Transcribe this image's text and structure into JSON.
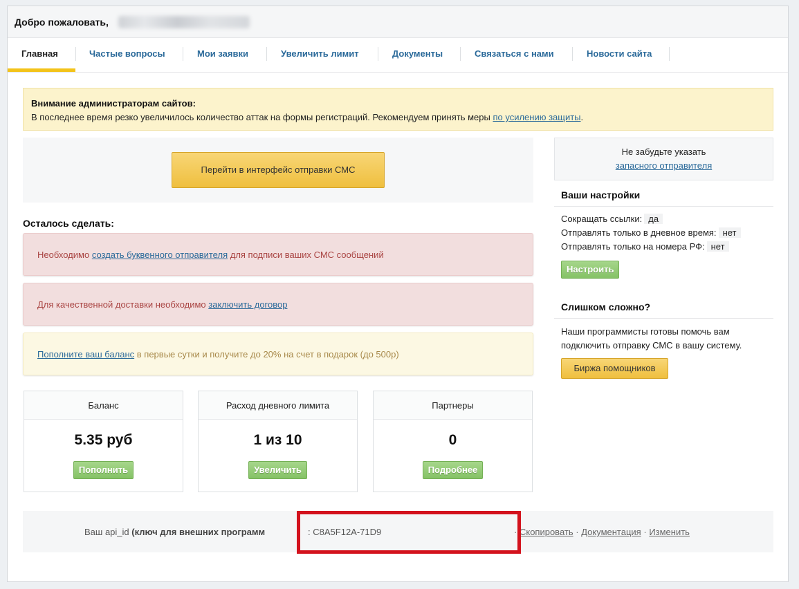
{
  "header": {
    "welcome": "Добро пожаловать,"
  },
  "nav": {
    "tabs": [
      {
        "label": "Главная"
      },
      {
        "label": "Частые вопросы"
      },
      {
        "label": "Мои заявки"
      },
      {
        "label": "Увеличить лимит"
      },
      {
        "label": "Документы"
      },
      {
        "label": "Связаться с нами"
      },
      {
        "label": "Новости сайта"
      }
    ]
  },
  "alert": {
    "title": "Внимание администраторам сайтов:",
    "text": "В последнее время резко увеличилось количество аттак на формы регистраций. Рекомендуем принять меры",
    "link": "по усилению защиты",
    "suffix": "."
  },
  "sms_button": "Перейти в интерфейс отправки СМС",
  "todo": {
    "title": "Осталось сделать:",
    "items": [
      {
        "prefix": "Необходимо",
        "link": "создать буквенного отправителя",
        "suffix": "для подписи ваших СМС сообщений"
      },
      {
        "prefix": "Для качественной доставки необходимо",
        "link": "заключить договор",
        "suffix": ""
      },
      {
        "prefix": "",
        "link": "Пополните ваш баланс",
        "suffix": "в первые сутки и получите до 20% на счет в подарок (до 500р)"
      }
    ]
  },
  "stats": [
    {
      "title": "Баланс",
      "value": "5.35 руб",
      "button": "Пополнить"
    },
    {
      "title": "Расход дневного лимита",
      "value": "1 из 10",
      "button": "Увеличить"
    },
    {
      "title": "Партнеры",
      "value": "0",
      "button": "Подробнее"
    }
  ],
  "api": {
    "label_prefix": "Ваш api_id",
    "label_bold": "(ключ для внешних программ",
    "separator": ":",
    "key": "C8A5F12A-71D9",
    "links": [
      "Скопировать",
      "Документация",
      "Изменить"
    ],
    "dot": "·"
  },
  "sidebar": {
    "note_text": "Не забудьте указать",
    "note_link": "запасного отправителя",
    "settings_title": "Ваши настройки",
    "settings": [
      {
        "label": "Сокращать ссылки:",
        "value": "да"
      },
      {
        "label": "Отправлять только в дневное время:",
        "value": "нет"
      },
      {
        "label": "Отправлять только на номера РФ:",
        "value": "нет"
      }
    ],
    "configure_button": "Настроить",
    "help_title": "Слишком сложно?",
    "help_text": "Наши программисты готовы помочь вам подключить отправку СМС в вашу систему.",
    "help_button": "Биржа помощников"
  },
  "colors": {
    "accent_yellow": "#f3c31a",
    "link_blue": "#2b6a9a",
    "highlight_red": "#d3121d",
    "button_green": "#85c266"
  }
}
